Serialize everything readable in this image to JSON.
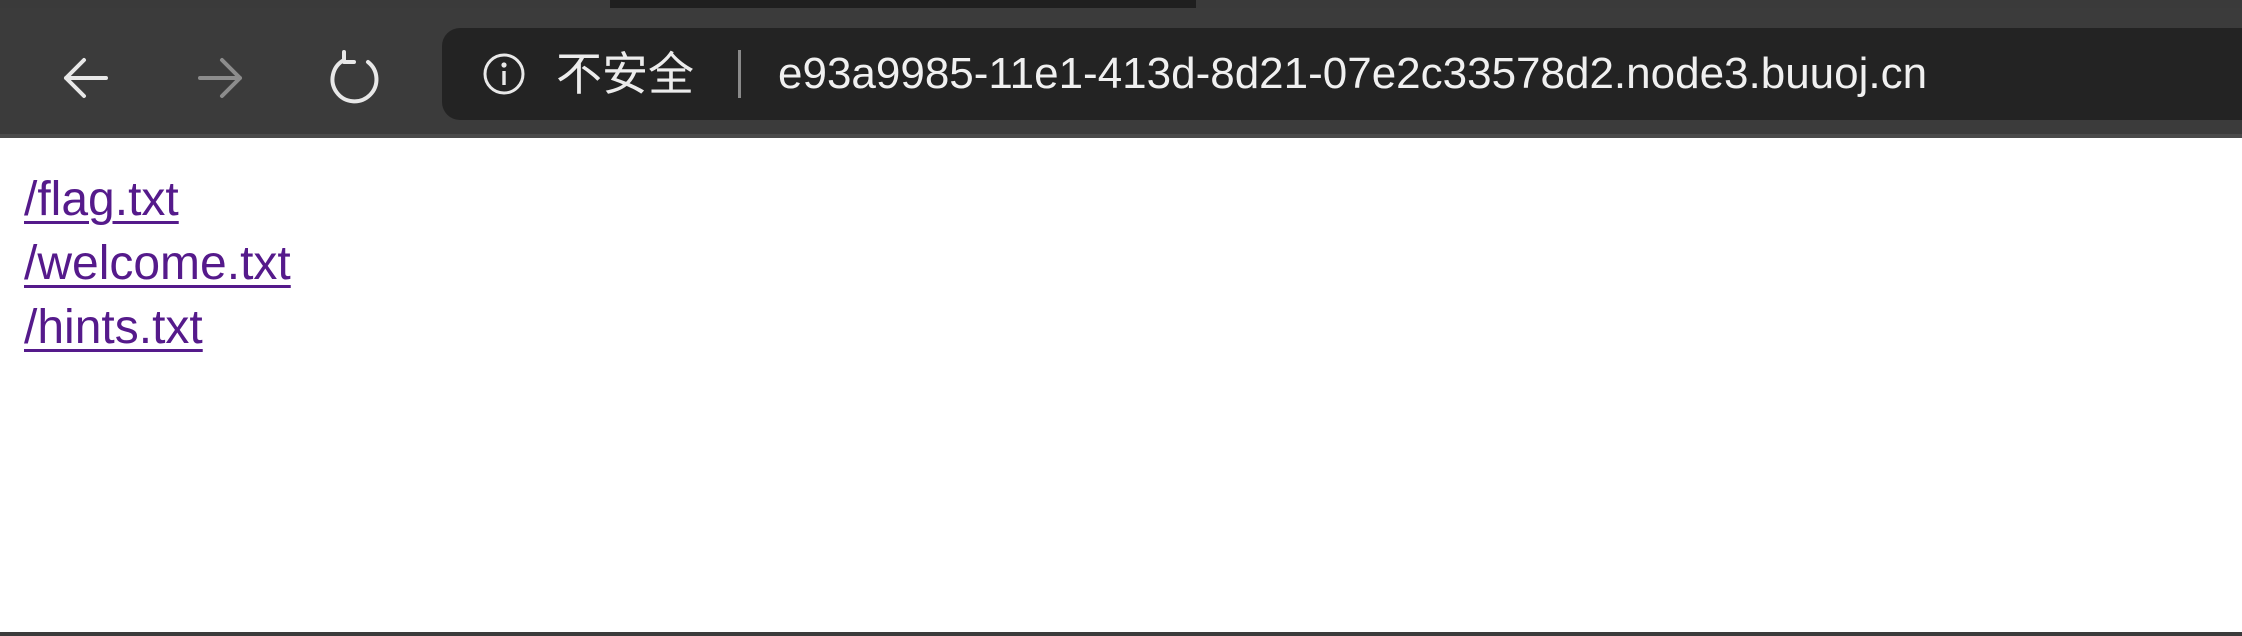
{
  "browser": {
    "toolbar_bg": "#3b3b3b",
    "omnibox_bg": "#232323",
    "nav": {
      "back_icon": "arrow-left-icon",
      "forward_icon": "arrow-right-icon",
      "reload_icon": "reload-icon"
    },
    "address_bar": {
      "security_icon": "info-icon",
      "security_label": "不安全",
      "url": "e93a9985-11e1-413d-8d21-07e2c33578d2.node3.buuoj.cn"
    }
  },
  "page": {
    "links": [
      {
        "text": "/flag.txt"
      },
      {
        "text": "/welcome.txt"
      },
      {
        "text": "/hints.txt"
      }
    ],
    "link_color": "#551a8b"
  }
}
